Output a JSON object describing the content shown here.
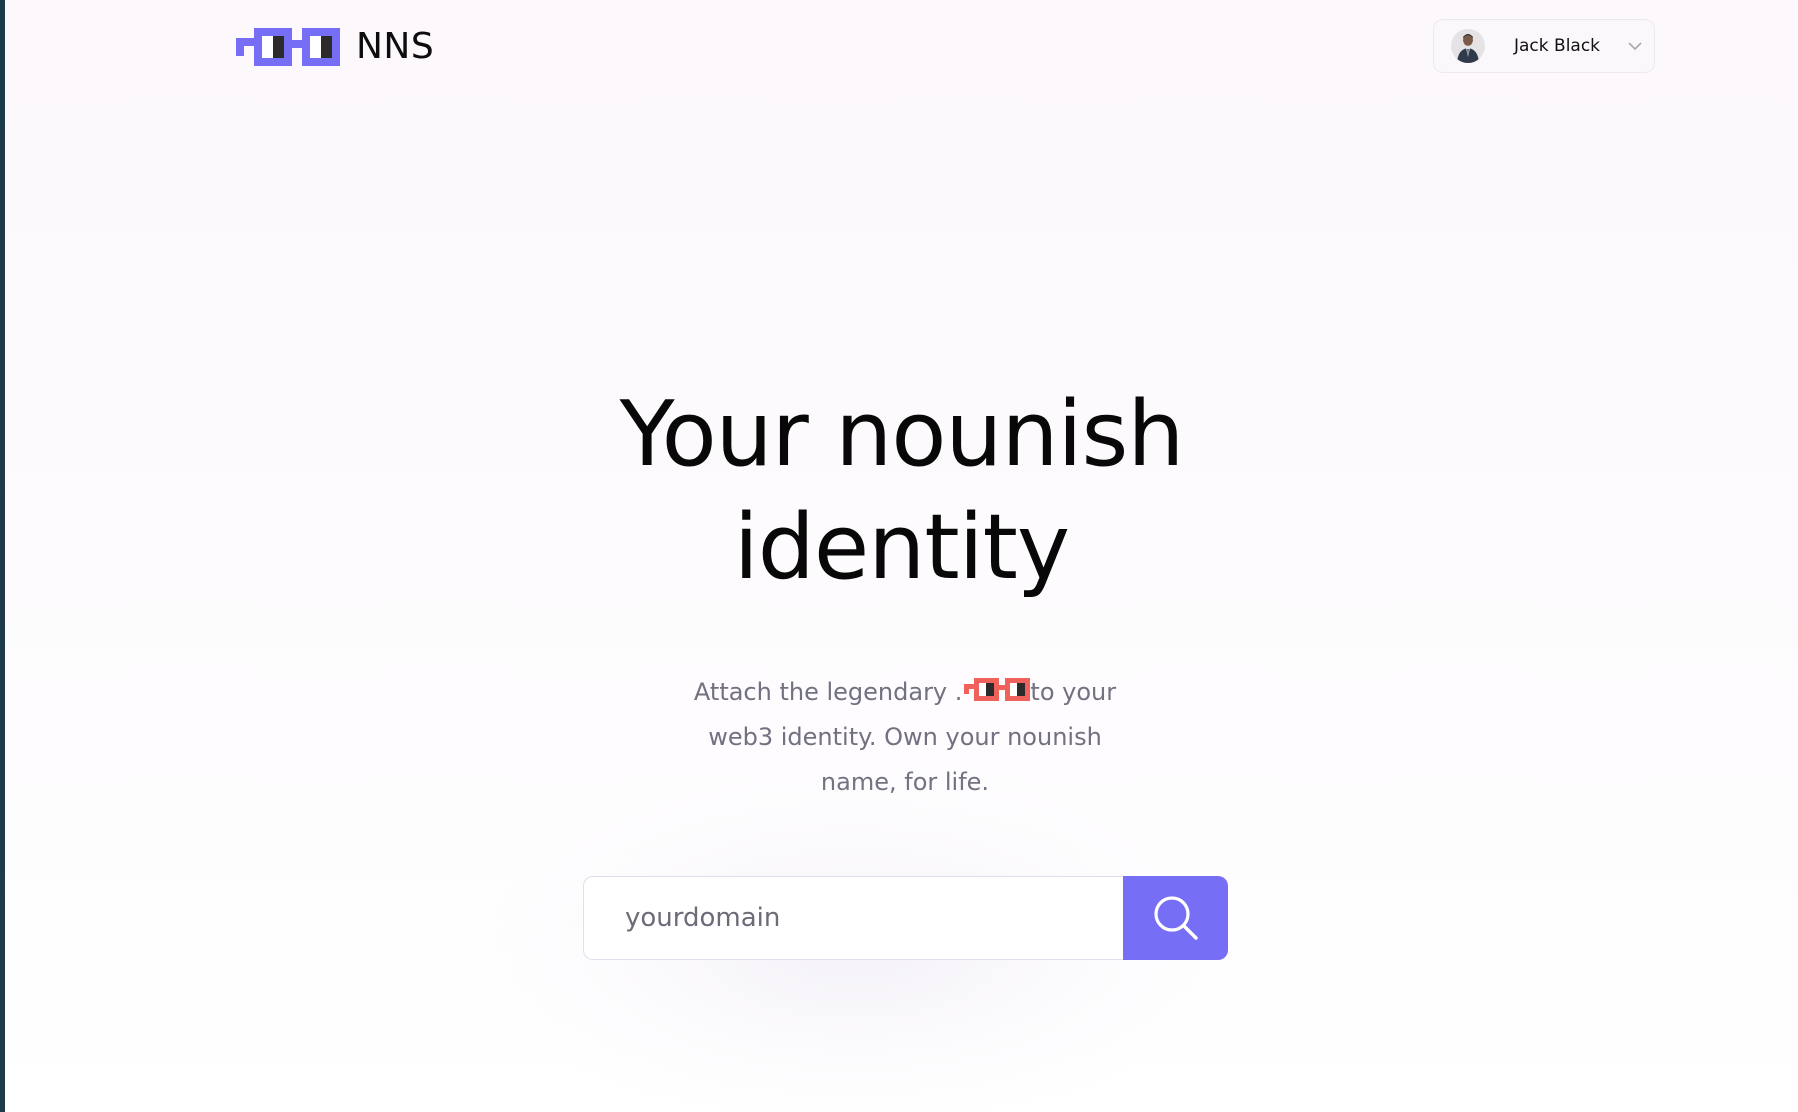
{
  "header": {
    "brand": "NNS",
    "logo_icon": "noggles-icon",
    "user": {
      "name": "Jack Black",
      "avatar_icon": "user-avatar",
      "chevron_icon": "chevron-down-icon"
    }
  },
  "hero": {
    "title_line1": "Your nounish",
    "title_line2": "identity",
    "subtitle_part1": "Attach the legendary .",
    "subtitle_part2": "to your",
    "subtitle_line2": "web3 identity. Own your nounish",
    "subtitle_line3": "name, for life.",
    "inline_icon": "noggles-red-icon"
  },
  "search": {
    "placeholder": "yourdomain",
    "button_icon": "search-icon"
  },
  "colors": {
    "accent": "#766ff6",
    "noggles_red": "#f0615b",
    "text_muted": "#737080",
    "background": "#fcf8fc"
  }
}
